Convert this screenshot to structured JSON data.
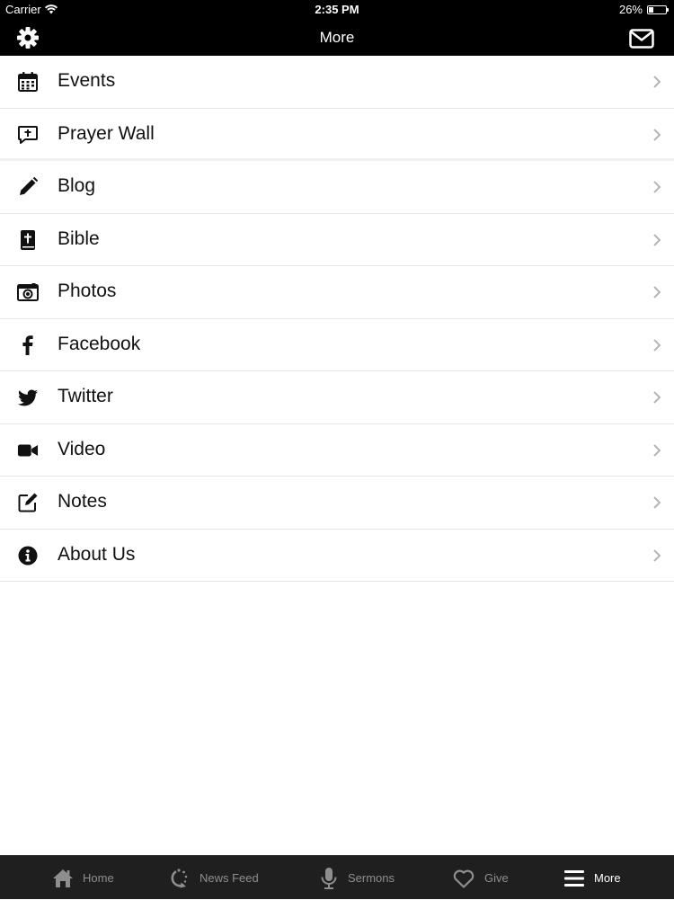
{
  "status_bar": {
    "carrier": "Carrier",
    "time": "2:35 PM",
    "battery_percent": "26%",
    "battery_level": 0.26
  },
  "nav_bar": {
    "title": "More",
    "left_icon": "gear-icon",
    "right_icon": "mail-icon"
  },
  "menu": {
    "items": [
      {
        "label": "Events",
        "icon": "calendar-icon"
      },
      {
        "label": "Prayer Wall",
        "icon": "prayer-bubble-icon"
      },
      {
        "label": "Blog",
        "icon": "pencil-icon"
      },
      {
        "label": "Bible",
        "icon": "bible-icon"
      },
      {
        "label": "Photos",
        "icon": "camera-icon"
      },
      {
        "label": "Facebook",
        "icon": "facebook-icon"
      },
      {
        "label": "Twitter",
        "icon": "twitter-icon"
      },
      {
        "label": "Video",
        "icon": "video-camera-icon"
      },
      {
        "label": "Notes",
        "icon": "edit-note-icon"
      },
      {
        "label": "About Us",
        "icon": "info-icon"
      }
    ]
  },
  "tab_bar": {
    "tabs": [
      {
        "label": "Home",
        "icon": "home-icon",
        "active": false
      },
      {
        "label": "News Feed",
        "icon": "refresh-icon",
        "active": false
      },
      {
        "label": "Sermons",
        "icon": "microphone-icon",
        "active": false
      },
      {
        "label": "Give",
        "icon": "heart-icon",
        "active": false
      },
      {
        "label": "More",
        "icon": "menu-icon",
        "active": true
      }
    ]
  },
  "colors": {
    "bar_background": "#000000",
    "tab_background": "#1f1f1f",
    "inactive_tab": "#8e8e8e",
    "active_tab": "#ffffff",
    "separator": "#e6e6e6"
  }
}
